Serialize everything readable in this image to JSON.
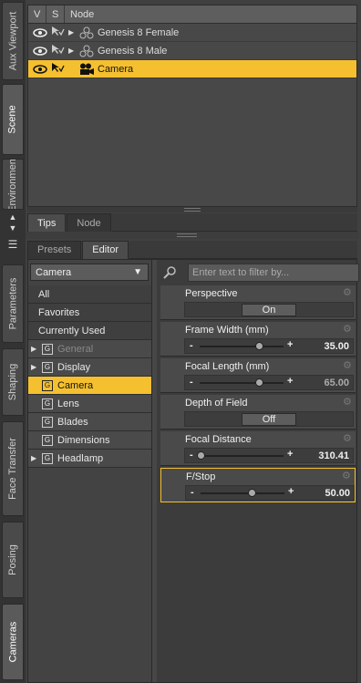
{
  "left_tabs": [
    "Aux Viewport",
    "Scene",
    "Environment",
    "Parameters",
    "Shaping",
    "Face Transfer",
    "Posing",
    "Cameras"
  ],
  "scene": {
    "headers": {
      "v": "V",
      "s": "S",
      "node": "Node"
    },
    "rows": [
      {
        "label": "Genesis 8 Female",
        "icon": "figure-icon",
        "selected": false
      },
      {
        "label": "Genesis 8 Male",
        "icon": "figure-icon",
        "selected": false
      },
      {
        "label": "Camera",
        "icon": "camera-icon",
        "selected": true
      }
    ]
  },
  "tips_tabs": {
    "tips": "Tips",
    "node": "Node"
  },
  "param_tabs": {
    "presets": "Presets",
    "editor": "Editor"
  },
  "category_dropdown": {
    "selected": "Camera"
  },
  "categories_top": [
    "All",
    "Favorites",
    "Currently Used"
  ],
  "categories": [
    {
      "label": "General",
      "expandable": true,
      "dim": true,
      "selected": false
    },
    {
      "label": "Display",
      "expandable": true,
      "dim": false,
      "selected": false
    },
    {
      "label": "Camera",
      "expandable": false,
      "dim": false,
      "selected": true
    },
    {
      "label": "Lens",
      "expandable": false,
      "dim": false,
      "selected": false
    },
    {
      "label": "Blades",
      "expandable": false,
      "dim": false,
      "selected": false
    },
    {
      "label": "Dimensions",
      "expandable": false,
      "dim": false,
      "selected": false
    },
    {
      "label": "Headlamp",
      "expandable": true,
      "dim": false,
      "selected": false
    }
  ],
  "filter": {
    "placeholder": "Enter text to filter by..."
  },
  "properties": [
    {
      "name": "Perspective",
      "type": "toggle",
      "value": "On"
    },
    {
      "name": "Frame Width (mm)",
      "type": "slider",
      "value": "35.00",
      "level": 0.72
    },
    {
      "name": "Focal Length (mm)",
      "type": "slider",
      "value": "65.00",
      "level": 0.72
    },
    {
      "name": "Depth of Field",
      "type": "toggle",
      "value": "Off"
    },
    {
      "name": "Focal Distance",
      "type": "slider",
      "value": "310.41",
      "level": 0.02
    },
    {
      "name": "F/Stop",
      "type": "slider",
      "value": "50.00",
      "level": 0.62
    }
  ],
  "colors": {
    "selection": "#f5c030"
  }
}
